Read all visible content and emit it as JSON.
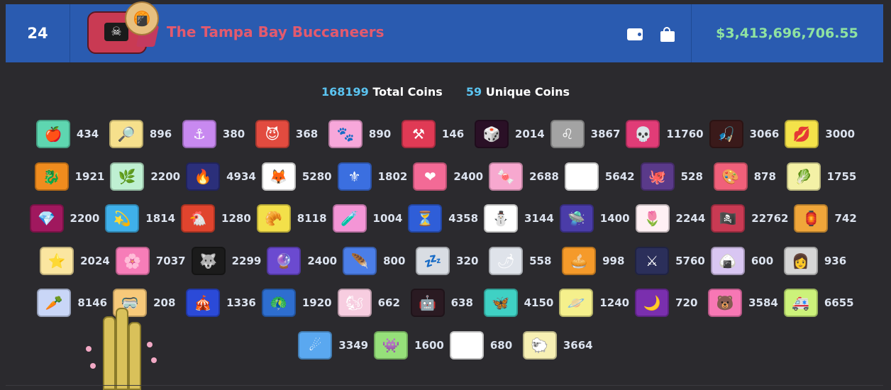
{
  "row": {
    "rank": "24",
    "team_name": "The Tampa Bay Buccaneers",
    "balance": "$3,413,696,706.55",
    "badge_icon": "pirate-flag",
    "actions": [
      {
        "icon": "wallet-icon"
      },
      {
        "icon": "shopping-bag-icon"
      }
    ]
  },
  "totals": {
    "total_coins": "168199",
    "total_label": "Total Coins",
    "unique_coins": "59",
    "unique_label": "Unique Coins"
  },
  "colors": {
    "row_bg": "#2a5bb0",
    "team_name": "#e35a6e",
    "balance": "#8fe3a1",
    "totals_num": "#5bc4f1",
    "page_bg": "#2b2a2e"
  },
  "coins": [
    [
      {
        "glyph": "🍎",
        "count": "434",
        "bg": "#5ed6b0"
      },
      {
        "glyph": "🔎",
        "count": "896",
        "bg": "#f6e08c"
      },
      {
        "glyph": "⚓",
        "count": "380",
        "bg": "#c889f0"
      },
      {
        "glyph": "😈",
        "count": "368",
        "bg": "#e24b3f"
      },
      {
        "glyph": "🐾",
        "count": "890",
        "bg": "#f7a7da"
      },
      {
        "glyph": "⚒",
        "count": "146",
        "bg": "#e03a55"
      },
      {
        "glyph": "🎲",
        "count": "2014",
        "bg": "#2a1026"
      },
      {
        "glyph": "♌",
        "count": "3867",
        "bg": "#a3a3a3"
      },
      {
        "glyph": "💀",
        "count": "11760",
        "bg": "#e13c77"
      },
      {
        "glyph": "🎣",
        "count": "3066",
        "bg": "#3a1a1a"
      },
      {
        "glyph": "💋",
        "count": "3000",
        "bg": "#f4e24a"
      }
    ],
    [
      {
        "glyph": "🐉",
        "count": "1921",
        "bg": "#f08c1e"
      },
      {
        "glyph": "🌿",
        "count": "2200",
        "bg": "#bff0d2"
      },
      {
        "glyph": "🔥",
        "count": "4934",
        "bg": "#2b2f7a"
      },
      {
        "glyph": "🦊",
        "count": "5280",
        "bg": "#ffffff"
      },
      {
        "glyph": "⚜",
        "count": "1802",
        "bg": "#3b6fe0"
      },
      {
        "glyph": "❤",
        "count": "2400",
        "bg": "#f36a96"
      },
      {
        "glyph": "🍬",
        "count": "2688",
        "bg": "#f7a8cf"
      },
      {
        "glyph": "▶",
        "count": "5642",
        "bg": "#ffffff"
      },
      {
        "glyph": "🐙",
        "count": "528",
        "bg": "#5a3a8a"
      },
      {
        "glyph": "🎨",
        "count": "878",
        "bg": "#f0607a"
      },
      {
        "glyph": "🥬",
        "count": "1755",
        "bg": "#f4f1a6"
      }
    ],
    [
      {
        "glyph": "💎",
        "count": "2200",
        "bg": "#a0185e"
      },
      {
        "glyph": "💫",
        "count": "1814",
        "bg": "#3fb0ea"
      },
      {
        "glyph": "🐔",
        "count": "1280",
        "bg": "#e0442e"
      },
      {
        "glyph": "🥐",
        "count": "8118",
        "bg": "#f3e04a"
      },
      {
        "glyph": "🧪",
        "count": "1004",
        "bg": "#f495d6"
      },
      {
        "glyph": "⏳",
        "count": "4358",
        "bg": "#2f5ed8"
      },
      {
        "glyph": "⛄",
        "count": "3144",
        "bg": "#ffffff"
      },
      {
        "glyph": "🛸",
        "count": "1400",
        "bg": "#4a3ca8"
      },
      {
        "glyph": "🌷",
        "count": "2244",
        "bg": "#fff0f4"
      },
      {
        "glyph": "🏴‍☠️",
        "count": "22762",
        "bg": "#c93a53"
      },
      {
        "glyph": "🏮",
        "count": "742",
        "bg": "#f0a63a"
      }
    ],
    [
      {
        "glyph": "⭐",
        "count": "2024",
        "bg": "#fbe6a0"
      },
      {
        "glyph": "🌸",
        "count": "7037",
        "bg": "#f77db8"
      },
      {
        "glyph": "🐺",
        "count": "2299",
        "bg": "#1b1b1b"
      },
      {
        "glyph": "🔮",
        "count": "2400",
        "bg": "#6b4ad0"
      },
      {
        "glyph": "🪶",
        "count": "800",
        "bg": "#4b7ee8"
      },
      {
        "glyph": "💤",
        "count": "320",
        "bg": "#d9dde3"
      },
      {
        "glyph": "🌶",
        "count": "558",
        "bg": "#dfe3ea"
      },
      {
        "glyph": "🥧",
        "count": "998",
        "bg": "#f59a2a"
      },
      {
        "glyph": "⚔",
        "count": "5760",
        "bg": "#2b2f5a"
      },
      {
        "glyph": "🍙",
        "count": "600",
        "bg": "#d9c6f2"
      },
      {
        "glyph": "👩",
        "count": "936",
        "bg": "#d6d6d6"
      }
    ],
    [
      {
        "glyph": "🥕",
        "count": "8146",
        "bg": "#c9d6f7"
      },
      {
        "glyph": "🥽",
        "count": "208",
        "bg": "#f7c97a"
      },
      {
        "glyph": "🎪",
        "count": "1336",
        "bg": "#2b4ad8"
      },
      {
        "glyph": "🦚",
        "count": "1920",
        "bg": "#2e6ecf"
      },
      {
        "glyph": "🐿",
        "count": "662",
        "bg": "#f7cde0"
      },
      {
        "glyph": "🤖",
        "count": "638",
        "bg": "#2a1a22"
      },
      {
        "glyph": "🦋",
        "count": "4150",
        "bg": "#3fd1c4"
      },
      {
        "glyph": "🪐",
        "count": "1240",
        "bg": "#f5f08c"
      },
      {
        "glyph": "🌙",
        "count": "720",
        "bg": "#7a2fae"
      },
      {
        "glyph": "🐻",
        "count": "3584",
        "bg": "#f777b4"
      },
      {
        "glyph": "🚑",
        "count": "6655",
        "bg": "#ccf27a"
      }
    ],
    [
      {
        "glyph": "☄",
        "count": "3349",
        "bg": "#5aa8f0"
      },
      {
        "glyph": "👾",
        "count": "1600",
        "bg": "#96e07a"
      },
      {
        "glyph": "☂",
        "count": "680",
        "bg": "#ffffff"
      },
      {
        "glyph": "🐑",
        "count": "3664",
        "bg": "#f7f0b4"
      }
    ]
  ]
}
